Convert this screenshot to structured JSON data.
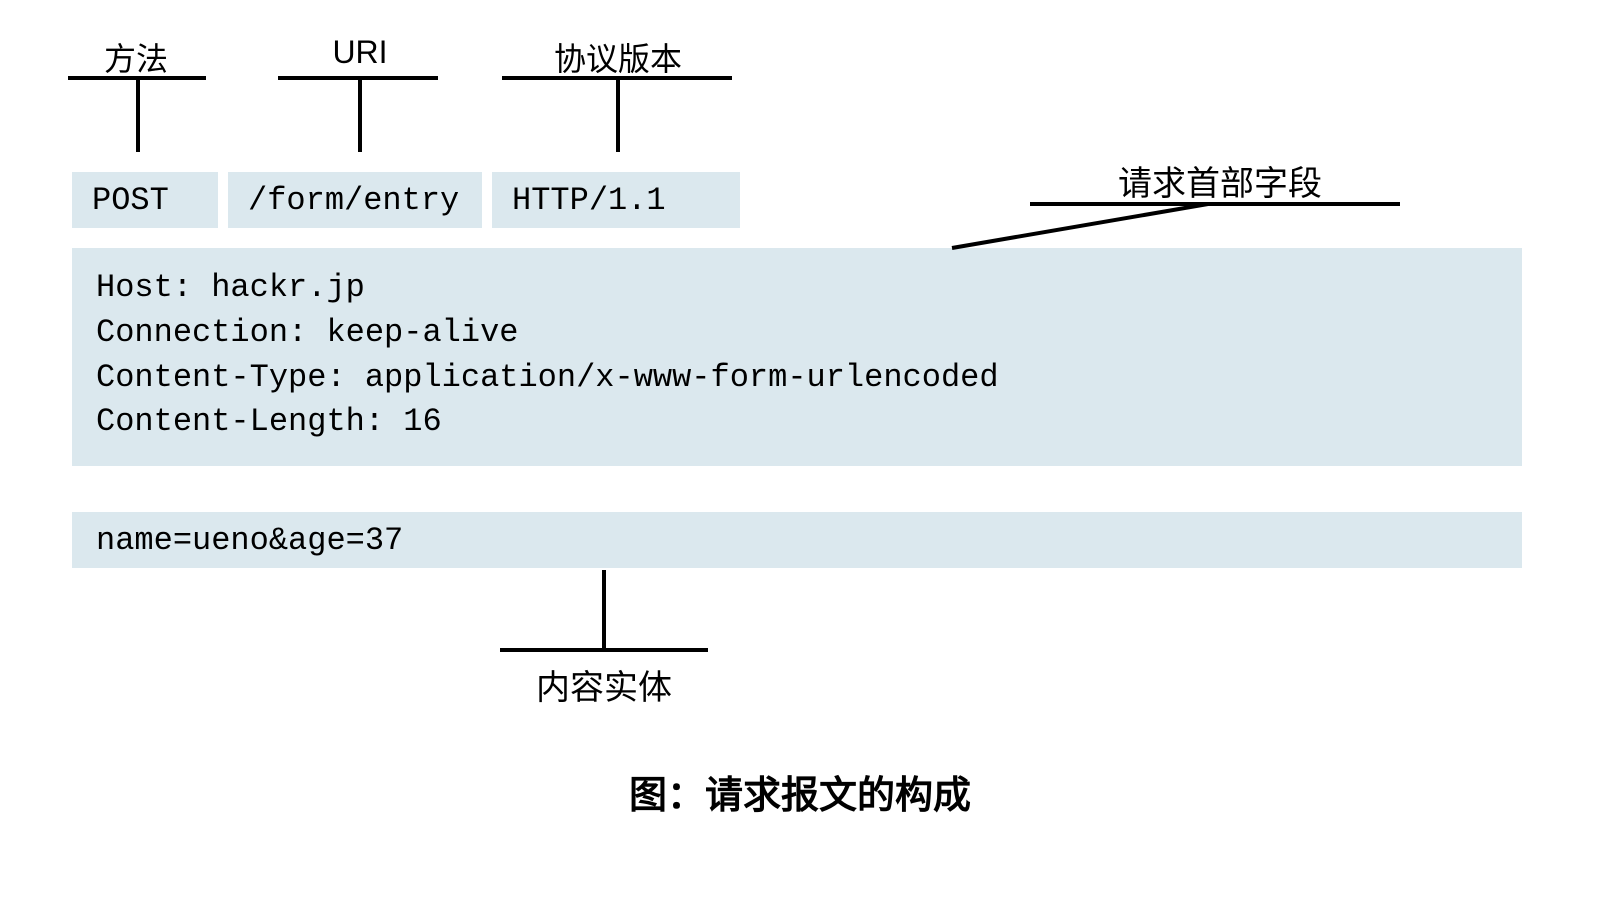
{
  "labels": {
    "method": "方法",
    "uri": "URI",
    "version": "协议版本",
    "request_headers": "请求首部字段",
    "entity_body": "内容实体",
    "caption": "图：请求报文的构成"
  },
  "request_line": {
    "method": "POST",
    "uri": "/form/entry",
    "version": "HTTP/1.1"
  },
  "headers": [
    "Host: hackr.jp",
    "Connection: keep-alive",
    "Content-Type: application/x-www-form-urlencoded",
    "Content-Length: 16"
  ],
  "body": "name=ueno&age=37"
}
